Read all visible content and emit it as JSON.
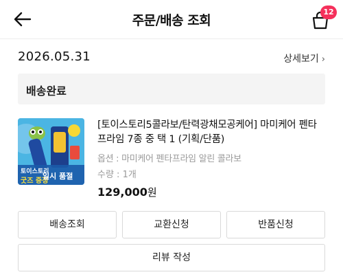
{
  "header": {
    "title": "주문/배송 조회",
    "cart_badge": "12",
    "back_icon": "arrow-left-icon",
    "cart_icon": "shopping-bag-icon"
  },
  "order": {
    "date": "2026.05.31",
    "detail_link": "상세보기",
    "status": "배송완료"
  },
  "product": {
    "name": "[토이스토리5콜라보/탄력광채모공케어] 마미케어 펜타프라임 7종 중 택 1 (기획/단품)",
    "option": "옵션 : 마미케어 펜타프라임 알린 콜라보",
    "quantity": "수량 : 1개",
    "price": "129,000",
    "currency": "원",
    "thumb_text_top": "토이스토리",
    "thumb_text_bottom": "굿즈 증정",
    "thumb_text_overlay": "일시 품절"
  },
  "actions": {
    "track": "배송조회",
    "exchange": "교환신청",
    "return": "반품신청",
    "review": "리뷰 작성"
  },
  "colors": {
    "badge": "#f5305b",
    "status_bg": "#f4f4f4",
    "button_border": "#d9d9d9"
  }
}
